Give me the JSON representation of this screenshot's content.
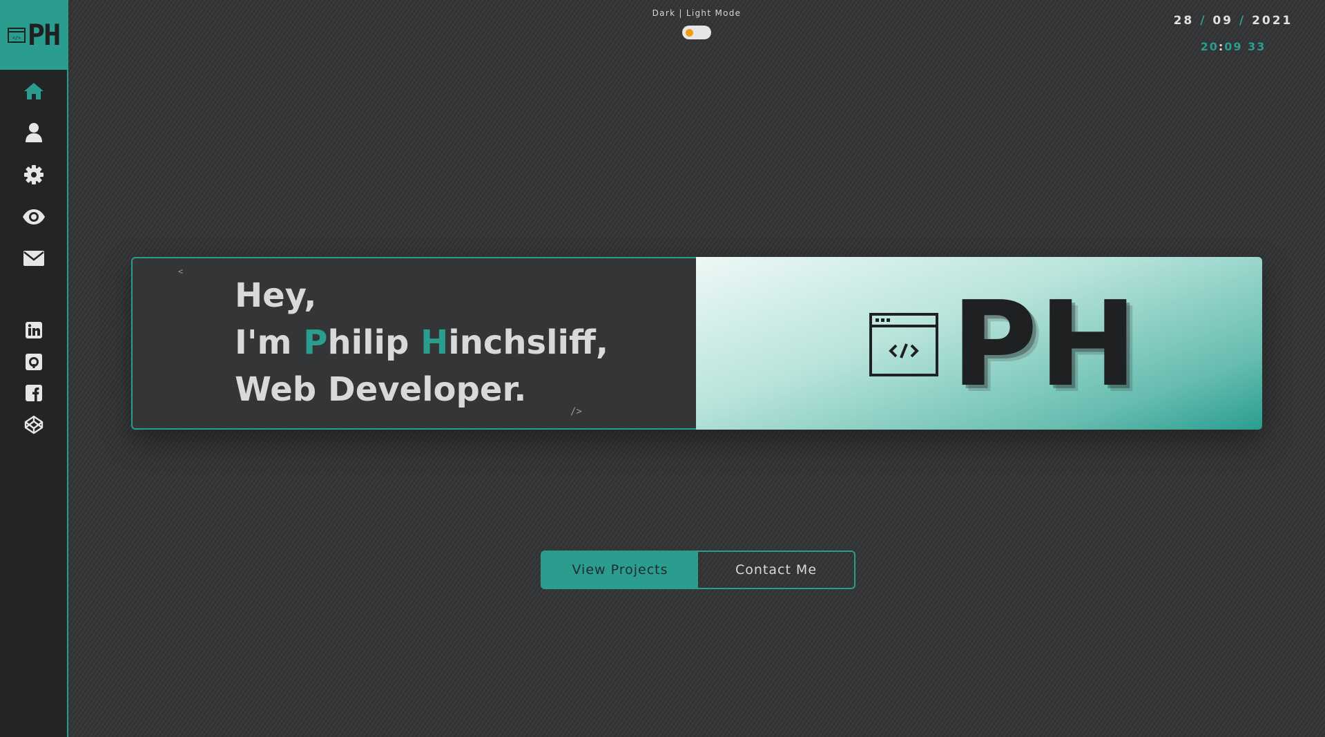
{
  "sidebar": {
    "logo_text": "PH",
    "nav_icons": [
      "home-icon",
      "user-icon",
      "gear-icon",
      "eye-icon",
      "envelope-icon"
    ],
    "social_icons": [
      "linkedin-icon",
      "github-icon",
      "facebook-icon",
      "codepen-icon"
    ]
  },
  "header": {
    "mode_label": "Dark | Light Mode",
    "mode_toggle_state": "dark",
    "date": {
      "day": "28",
      "separator": "/",
      "month": "09",
      "year": "2021"
    },
    "time": {
      "hours": "20",
      "colon": ":",
      "minutes": "09",
      "seconds": "33"
    }
  },
  "hero": {
    "code_open": "<",
    "code_close": "/>",
    "line1": "Hey,",
    "line2_prefix": "I'm ",
    "line2_first_initial": "P",
    "line2_first_rest": "hilip ",
    "line2_last_initial": "H",
    "line2_last_rest": "inchsliff,",
    "line3": "Web Developer.",
    "brand_letters": "PH"
  },
  "actions": {
    "view_projects": "View Projects",
    "contact_me": "Contact Me"
  },
  "colors": {
    "accent": "#2a9d8f",
    "background": "#343537",
    "sidebar": "#232425",
    "toggle_knob": "#f39c12"
  }
}
